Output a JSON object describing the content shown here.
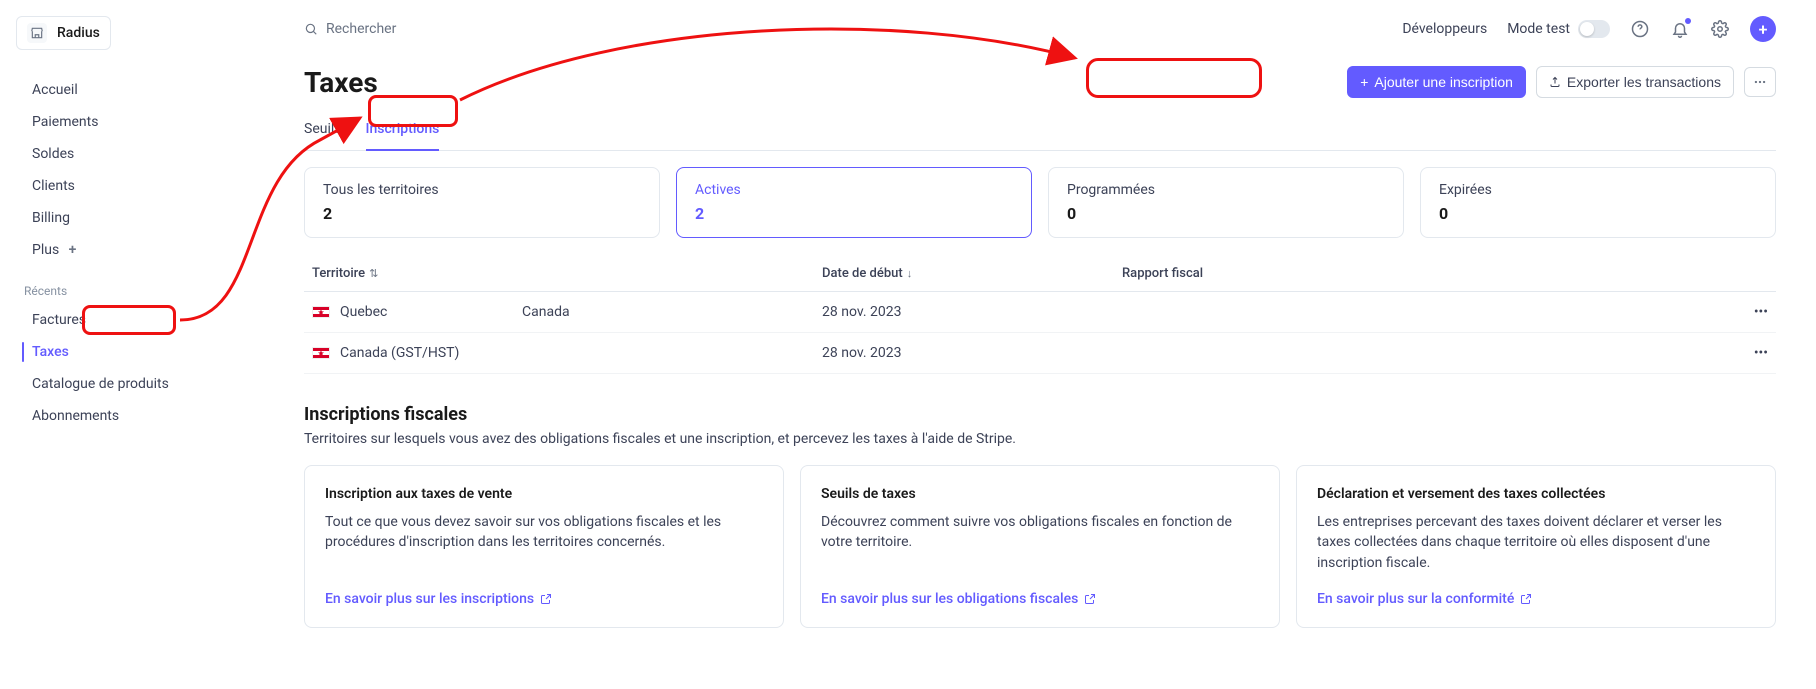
{
  "brand": {
    "name": "Radius"
  },
  "search": {
    "placeholder": "Rechercher"
  },
  "topnav": {
    "dev": "Développeurs",
    "test_mode": "Mode test"
  },
  "sidebar": {
    "items": [
      {
        "label": "Accueil"
      },
      {
        "label": "Paiements"
      },
      {
        "label": "Soldes"
      },
      {
        "label": "Clients"
      },
      {
        "label": "Billing"
      },
      {
        "label": "Plus"
      }
    ],
    "recent_heading": "Récents",
    "recent": [
      {
        "label": "Factures"
      },
      {
        "label": "Taxes",
        "active": true
      },
      {
        "label": "Catalogue de produits"
      },
      {
        "label": "Abonnements"
      }
    ]
  },
  "page": {
    "title": "Taxes",
    "add_button": "Ajouter une inscription",
    "export_button": "Exporter les transactions"
  },
  "tabs": [
    {
      "label": "Seuils"
    },
    {
      "label": "Inscriptions",
      "active": true
    }
  ],
  "stats": [
    {
      "label": "Tous les territoires",
      "value": "2"
    },
    {
      "label": "Actives",
      "value": "2",
      "active": true
    },
    {
      "label": "Programmées",
      "value": "0"
    },
    {
      "label": "Expirées",
      "value": "0"
    }
  ],
  "table": {
    "headers": {
      "territory": "Territoire",
      "start": "Date de début",
      "report": "Rapport fiscal"
    },
    "rows": [
      {
        "name": "Quebec",
        "country": "Canada",
        "start": "28 nov. 2023"
      },
      {
        "name": "Canada (GST/HST)",
        "country": "",
        "start": "28 nov. 2023"
      }
    ]
  },
  "section": {
    "title": "Inscriptions fiscales",
    "desc": "Territoires sur lesquels vous avez des obligations fiscales et une inscription, et percevez les taxes à l'aide de Stripe."
  },
  "cards": [
    {
      "title": "Inscription aux taxes de vente",
      "body": "Tout ce que vous devez savoir sur vos obligations fiscales et les procédures d'inscription dans les territoires concernés.",
      "link": "En savoir plus sur les inscriptions"
    },
    {
      "title": "Seuils de taxes",
      "body": "Découvrez comment suivre vos obligations fiscales en fonction de votre territoire.",
      "link": "En savoir plus sur les obligations fiscales"
    },
    {
      "title": "Déclaration et versement des taxes collectées",
      "body": "Les entreprises percevant des taxes doivent déclarer et verser les taxes collectées dans chaque territoire où elles disposent d'une inscription fiscale.",
      "link": "En savoir plus sur la conformité"
    }
  ]
}
